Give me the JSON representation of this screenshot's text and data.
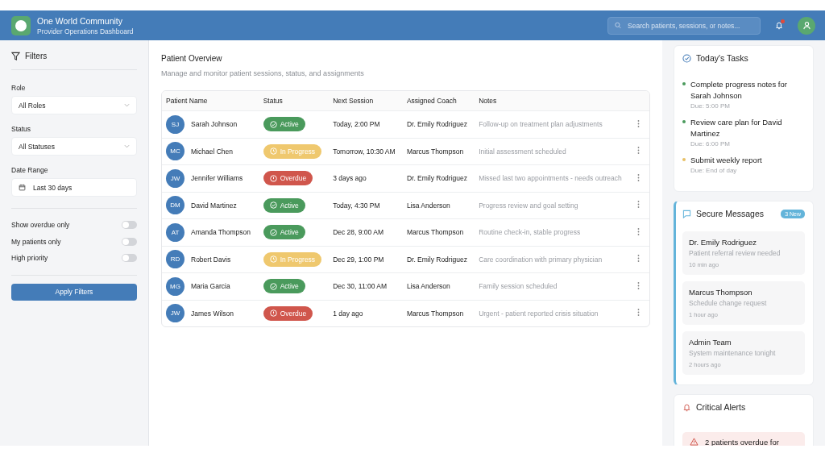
{
  "header": {
    "title": "One World Community",
    "subtitle": "Provider Operations Dashboard",
    "search": {
      "placeholder": "Search patients, sessions, or notes..."
    },
    "notifications": {
      "unread": true
    }
  },
  "filters": {
    "title": "Filters",
    "selects": [
      {
        "label": "Role",
        "value": "All Roles",
        "kind": "dropdown"
      },
      {
        "label": "Status",
        "value": "All Statuses",
        "kind": "dropdown"
      },
      {
        "label": "Date Range",
        "value": "Last 30 days",
        "kind": "date"
      }
    ],
    "toggles": [
      {
        "label": "Show overdue only",
        "on": false
      },
      {
        "label": "My patients only",
        "on": false
      },
      {
        "label": "High priority",
        "on": false
      }
    ],
    "apply_button": "Apply Filters"
  },
  "overview": {
    "title": "Patient Overview",
    "subtitle": "Manage and monitor patient sessions, status, and assignments",
    "table": {
      "columns": [
        "Patient Name",
        "Status",
        "Next Session",
        "Assigned Coach",
        "Notes"
      ],
      "rows": [
        {
          "initials": "SJ",
          "name": "Sarah Johnson",
          "status": {
            "label": "Active",
            "kind": "active"
          },
          "next_session": "Today, 2:00 PM",
          "coach": "Dr. Emily Rodriguez",
          "notes": "Follow-up on treatment plan adjustments"
        },
        {
          "initials": "MC",
          "name": "Michael Chen",
          "status": {
            "label": "In Progress",
            "kind": "in_progress"
          },
          "next_session": "Tomorrow, 10:30 AM",
          "coach": "Marcus Thompson",
          "notes": "Initial assessment scheduled"
        },
        {
          "initials": "JW",
          "name": "Jennifer Williams",
          "status": {
            "label": "Overdue",
            "kind": "overdue"
          },
          "next_session": "3 days ago",
          "coach": "Dr. Emily Rodriguez",
          "notes": "Missed last two appointments - needs outreach"
        },
        {
          "initials": "DM",
          "name": "David Martinez",
          "status": {
            "label": "Active",
            "kind": "active"
          },
          "next_session": "Today, 4:30 PM",
          "coach": "Lisa Anderson",
          "notes": "Progress review and goal setting"
        },
        {
          "initials": "AT",
          "name": "Amanda Thompson",
          "status": {
            "label": "Active",
            "kind": "active"
          },
          "next_session": "Dec 28, 9:00 AM",
          "coach": "Marcus Thompson",
          "notes": "Routine check-in, stable progress"
        },
        {
          "initials": "RD",
          "name": "Robert Davis",
          "status": {
            "label": "In Progress",
            "kind": "in_progress"
          },
          "next_session": "Dec 29, 1:00 PM",
          "coach": "Dr. Emily Rodriguez",
          "notes": "Care coordination with primary physician"
        },
        {
          "initials": "MG",
          "name": "Maria Garcia",
          "status": {
            "label": "Active",
            "kind": "active"
          },
          "next_session": "Dec 30, 11:00 AM",
          "coach": "Lisa Anderson",
          "notes": "Family session scheduled"
        },
        {
          "initials": "JW",
          "name": "James Wilson",
          "status": {
            "label": "Overdue",
            "kind": "overdue"
          },
          "next_session": "1 day ago",
          "coach": "Marcus Thompson",
          "notes": "Urgent - patient reported crisis situation"
        }
      ]
    }
  },
  "tasks": {
    "title": "Today's Tasks",
    "items": [
      {
        "text": "Complete progress notes for Sarah Johnson",
        "due": "Due: 5:00 PM",
        "color": "#4a9a5c"
      },
      {
        "text": "Review care plan for David Martinez",
        "due": "Due: 6:00 PM",
        "color": "#4a9a5c"
      },
      {
        "text": "Submit weekly report",
        "due": "Due: End of day",
        "color": "#e8c066"
      }
    ]
  },
  "messages": {
    "title": "Secure Messages",
    "badge": "3 New",
    "items": [
      {
        "sender": "Dr. Emily Rodriguez",
        "text": "Patient referral review needed",
        "time": "10 min ago"
      },
      {
        "sender": "Marcus Thompson",
        "text": "Schedule change request",
        "time": "1 hour ago"
      },
      {
        "sender": "Admin Team",
        "text": "System maintenance tonight",
        "time": "2 hours ago"
      }
    ]
  },
  "alerts": {
    "title": "Critical Alerts",
    "items": [
      {
        "text": "2 patients overdue for"
      }
    ]
  }
}
